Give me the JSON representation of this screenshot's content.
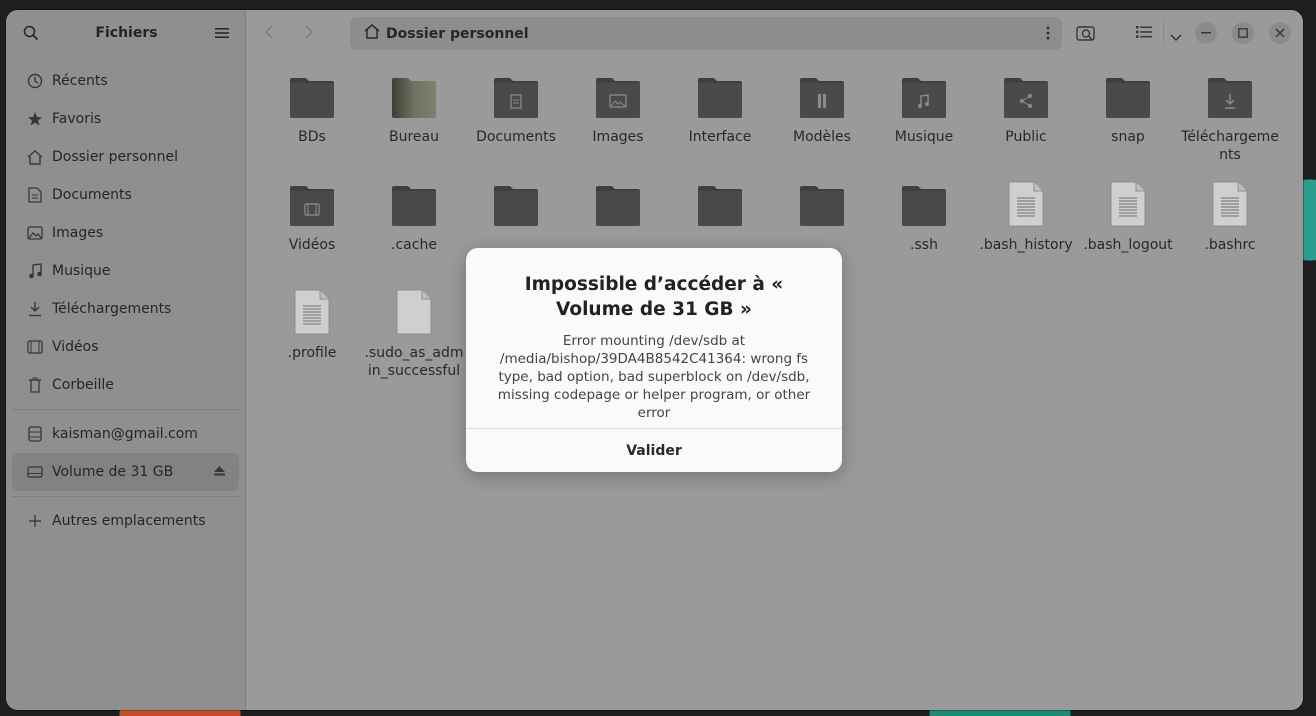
{
  "sidebar": {
    "title": "Fichiers",
    "places": [
      {
        "label": "Récents",
        "icon": "clock-icon"
      },
      {
        "label": "Favoris",
        "icon": "star-icon"
      },
      {
        "label": "Dossier personnel",
        "icon": "home-icon"
      },
      {
        "label": "Documents",
        "icon": "document-icon"
      },
      {
        "label": "Images",
        "icon": "image-icon"
      },
      {
        "label": "Musique",
        "icon": "music-icon"
      },
      {
        "label": "Téléchargements",
        "icon": "download-icon"
      },
      {
        "label": "Vidéos",
        "icon": "video-icon"
      },
      {
        "label": "Corbeille",
        "icon": "trash-icon"
      }
    ],
    "accounts": [
      {
        "label": "kaisman@gmail.com",
        "icon": "network-drive-icon"
      }
    ],
    "devices": [
      {
        "label": "Volume de 31 GB",
        "icon": "drive-icon",
        "active": true
      }
    ],
    "other": {
      "label": "Autres emplacements",
      "icon": "plus-icon"
    }
  },
  "header": {
    "path": "Dossier personnel"
  },
  "files": [
    {
      "name": "BDs",
      "kind": "folder"
    },
    {
      "name": "Bureau",
      "kind": "folder-desktop"
    },
    {
      "name": "Documents",
      "kind": "folder-documents"
    },
    {
      "name": "Images",
      "kind": "folder-images"
    },
    {
      "name": "Interface",
      "kind": "folder"
    },
    {
      "name": "Modèles",
      "kind": "folder-templates"
    },
    {
      "name": "Musique",
      "kind": "folder-music"
    },
    {
      "name": "Public",
      "kind": "folder-public"
    },
    {
      "name": "snap",
      "kind": "folder"
    },
    {
      "name": "Télécharge­ments",
      "kind": "folder-download"
    },
    {
      "name": "Vidéos",
      "kind": "folder-videos"
    },
    {
      "name": ".cache",
      "kind": "folder"
    },
    {
      "name": "",
      "kind": "folder"
    },
    {
      "name": "",
      "kind": "folder"
    },
    {
      "name": "",
      "kind": "folder"
    },
    {
      "name": "",
      "kind": "folder"
    },
    {
      "name": ".ssh",
      "kind": "folder"
    },
    {
      "name": ".bash_history",
      "kind": "text"
    },
    {
      "name": ".bash_logout",
      "kind": "text"
    },
    {
      "name": ".bashrc",
      "kind": "text"
    },
    {
      "name": ".profile",
      "kind": "text"
    },
    {
      "name": ".sudo_as_admin_successful",
      "kind": "blank"
    }
  ],
  "dialog": {
    "title": "Impossible d’accéder à « Volume de 31 GB »",
    "message": "Error mounting /dev/sdb at /media/bishop/39DA4B8542C41364: wrong fs type, bad option, bad superblock on /dev/sdb, missing codepage or helper program, or other error",
    "button": "Valider"
  },
  "colors": {
    "folder": "#4a4a4a",
    "folder_tab": "#3e3e3e",
    "dialog_bg": "#fafafa"
  }
}
